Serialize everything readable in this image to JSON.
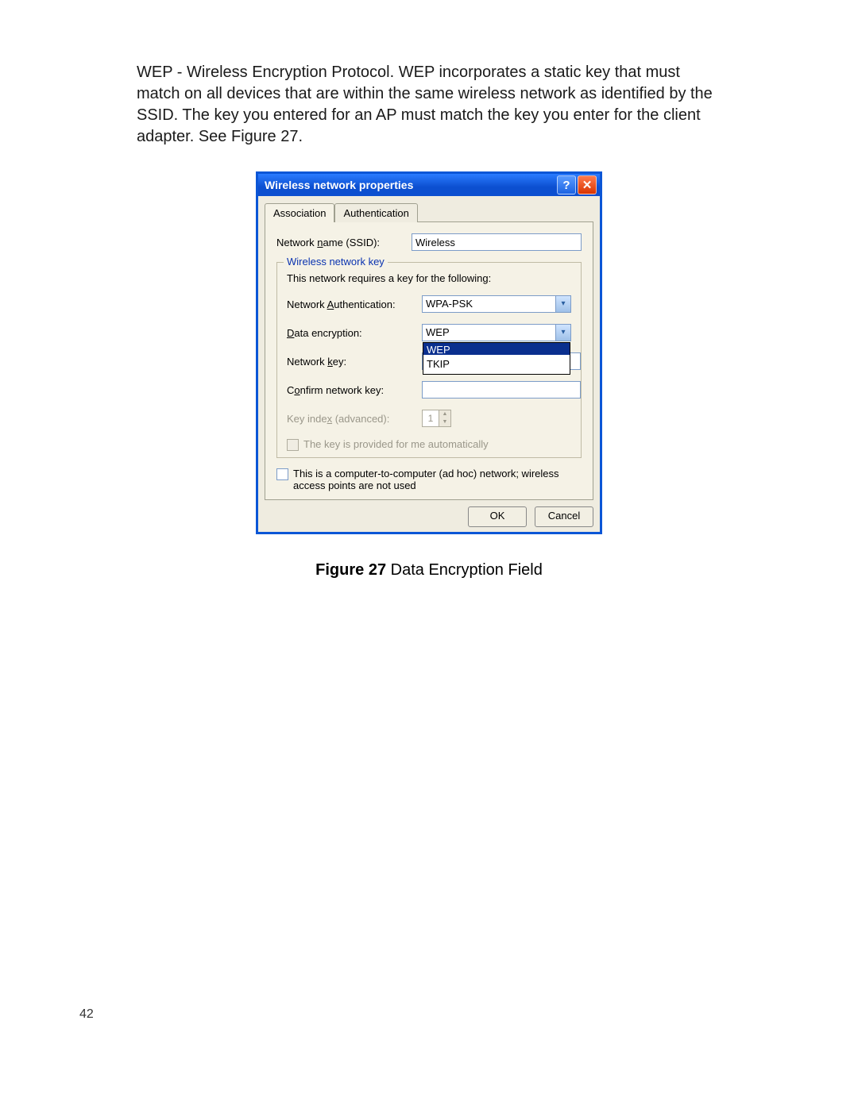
{
  "paragraph": "WEP - Wireless Encryption Protocol. WEP incorporates a static key that must match on all devices that are within the same wireless network as identified by the SSID. The key you entered for an AP must match the key you enter for the client adapter. See Figure 27.",
  "dialog": {
    "title": "Wireless network properties",
    "tabs": {
      "t1": "Association",
      "t2": "Authentication"
    },
    "ssid": {
      "label_pre": "Network ",
      "label_u": "n",
      "label_post": "ame (SSID):",
      "value": "Wireless"
    },
    "group": {
      "legend": "Wireless network key",
      "intro": "This network requires a key for the following:",
      "auth": {
        "label_pre": "Network ",
        "label_u": "A",
        "label_post": "uthentication:",
        "value": "WPA-PSK"
      },
      "enc": {
        "label_u": "D",
        "label_post": "ata encryption:",
        "value": "WEP",
        "options": {
          "o1": "WEP",
          "o2": "TKIP"
        }
      },
      "key": {
        "label_pre": "Network ",
        "label_u": "k",
        "label_post": "ey:"
      },
      "confirm": {
        "label_pre": "C",
        "label_u": "o",
        "label_post": "nfirm network key:"
      },
      "index": {
        "label_pre": "Key inde",
        "label_u": "x",
        "label_post": " (advanced):",
        "value": "1"
      },
      "auto": {
        "label_u": "T",
        "label_post": "he key is provided for me automatically"
      }
    },
    "adhoc": {
      "label_pre": "This is a ",
      "label_u": "c",
      "label_post": "omputer-to-computer (ad hoc) network; wireless access points are not used"
    },
    "buttons": {
      "ok": "OK",
      "cancel": "Cancel"
    }
  },
  "caption": {
    "bold": "Figure 27",
    "rest": "  Data Encryption Field"
  },
  "pagenum": "42"
}
